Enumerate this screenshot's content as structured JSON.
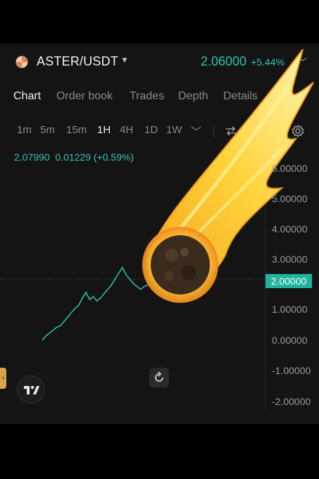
{
  "header": {
    "pair": "ASTER/USDT",
    "price": "2.06000",
    "change": "+5.44%"
  },
  "tabs": [
    {
      "label": "Chart",
      "active": true
    },
    {
      "label": "Order book",
      "active": false
    },
    {
      "label": "Trades",
      "active": false
    },
    {
      "label": "Depth",
      "active": false
    },
    {
      "label": "Details",
      "active": false
    }
  ],
  "intervals": [
    {
      "label": "1m",
      "active": false
    },
    {
      "label": "5m",
      "active": false
    },
    {
      "label": "15m",
      "active": false
    },
    {
      "label": "1H",
      "active": true
    },
    {
      "label": "4H",
      "active": false
    },
    {
      "label": "1D",
      "active": false
    },
    {
      "label": "1W",
      "active": false
    }
  ],
  "ohlc": {
    "close": "2.07990",
    "change": "0.01229",
    "change_pct": "(+0.59%)"
  },
  "colors": {
    "accent": "#2ec5b0",
    "price_tag": "#1fb3a0",
    "background": "#141414"
  },
  "icons": {
    "logo": "aster-logo-icon",
    "caret": "chevron-down-icon",
    "compare": "compare-arrows-icon",
    "settings": "gear-icon",
    "reset": "reset-icon",
    "watermark": "tradingview-logo-icon",
    "overlay": "falling-meteor-illustration"
  },
  "chart_data": {
    "type": "line",
    "y_ticks": [
      "6.00000",
      "5.00000",
      "4.00000",
      "3.00000",
      "2.00000",
      "1.00000",
      "0.00000",
      "-1.00000",
      "-2.00000"
    ],
    "current_price_label": "2.00000",
    "ylim": [
      -2,
      6
    ],
    "series": [
      {
        "values": [
          0.1,
          0.25,
          0.35,
          0.45,
          0.55,
          0.6,
          0.75,
          0.9,
          1.05,
          1.2,
          1.3,
          1.55,
          1.75,
          1.5,
          1.6,
          1.45,
          1.55,
          1.7,
          1.85,
          2.0,
          2.2,
          2.4,
          2.6,
          2.35,
          2.2,
          2.05,
          1.95,
          1.85,
          1.95,
          2.0
        ]
      }
    ]
  }
}
